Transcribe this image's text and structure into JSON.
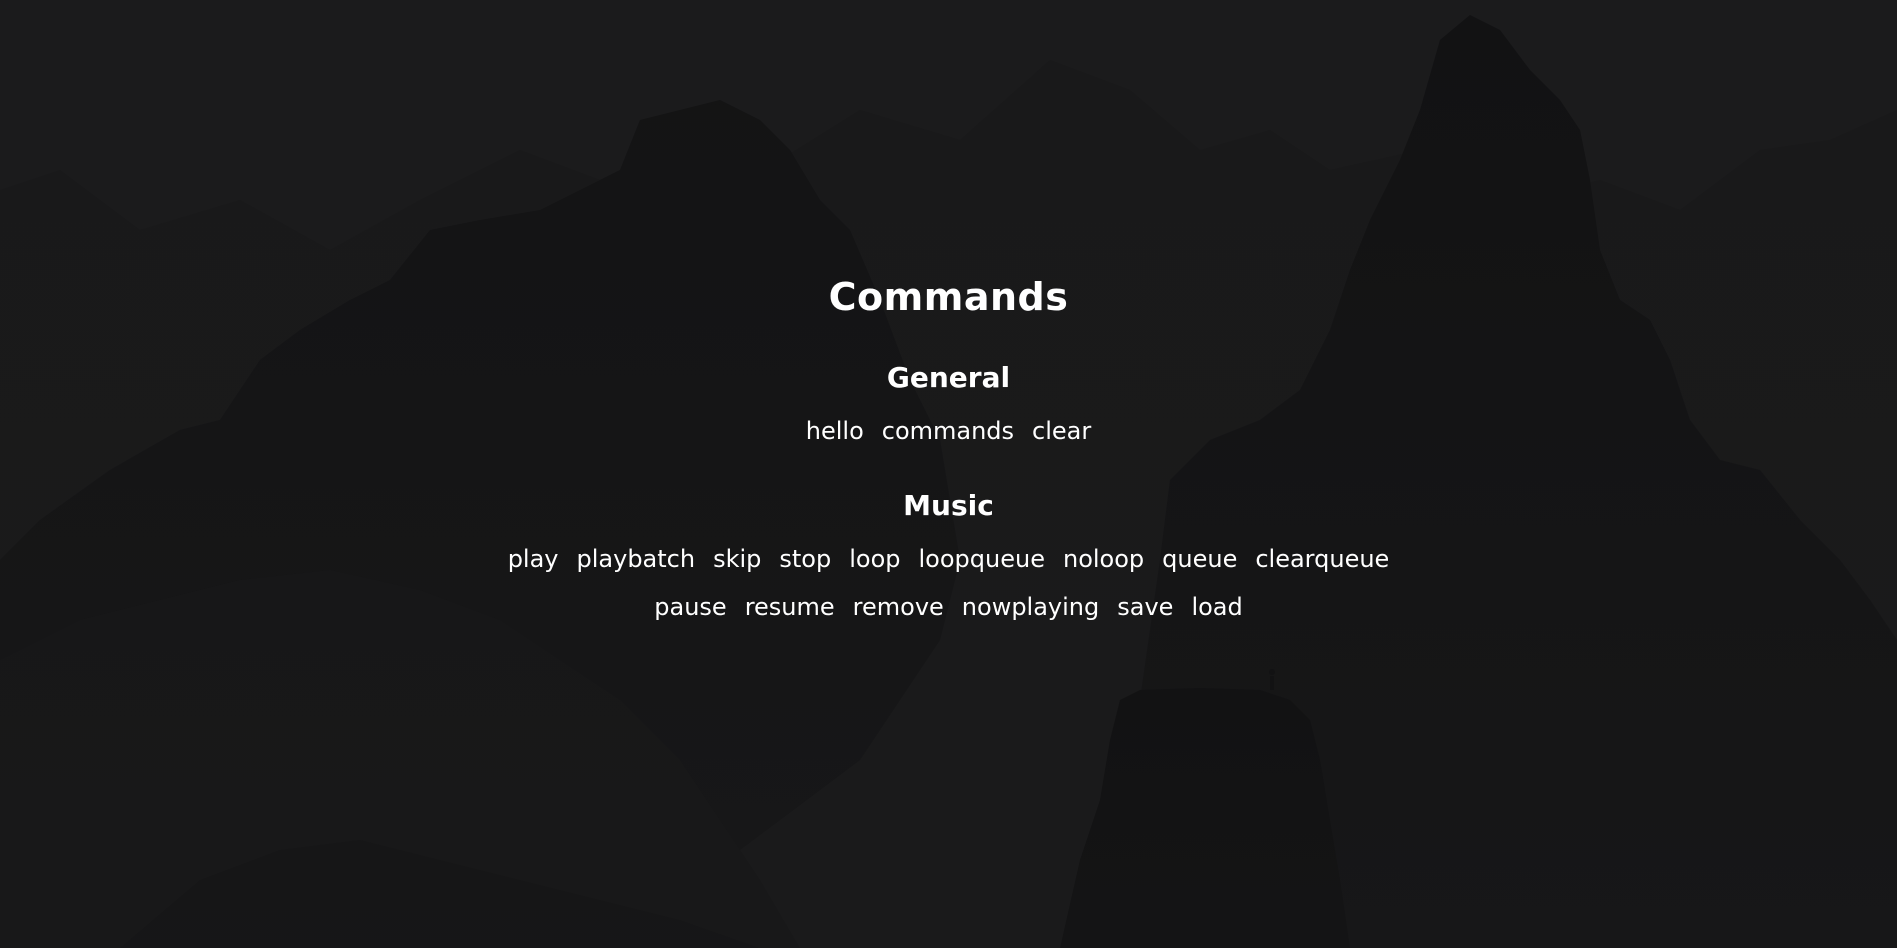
{
  "page": {
    "title": "Commands"
  },
  "sections": {
    "general": {
      "title": "General",
      "commands": [
        "hello",
        "commands",
        "clear"
      ]
    },
    "music": {
      "title": "Music",
      "row1": [
        "play",
        "playbatch",
        "skip",
        "stop",
        "loop",
        "loopqueue",
        "noloop",
        "queue",
        "clearqueue"
      ],
      "row2": [
        "pause",
        "resume",
        "remove",
        "nowplaying",
        "save",
        "load"
      ]
    }
  },
  "colors": {
    "background": "#1b1b1c",
    "mountain_dark": "#0f0f10",
    "mountain_mid": "#141415",
    "text": "#ffffff"
  }
}
